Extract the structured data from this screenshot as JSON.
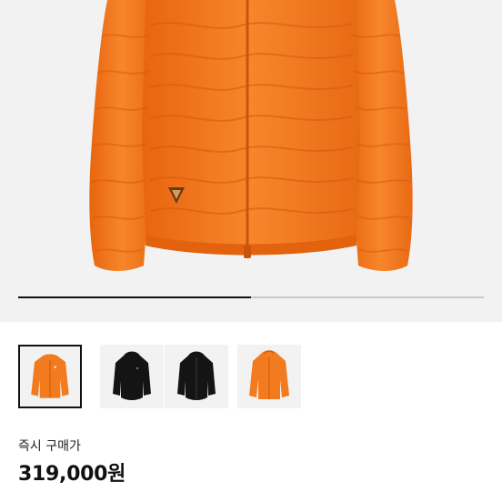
{
  "gallery": {
    "progress_fraction": 0.5,
    "image_count": 4,
    "selected_index": 0,
    "thumbnails": [
      {
        "icon": "orange-jacket-icon",
        "color": "#f27a1f"
      },
      {
        "icon": "black-jacket-icon",
        "color": "#141414"
      },
      {
        "icon": "black-jacket-icon",
        "color": "#141414"
      },
      {
        "icon": "orange-jacket-icon",
        "color": "#f27a1f"
      }
    ]
  },
  "product": {
    "price_label": "즉시 구매가",
    "price": "319,000원"
  },
  "colors": {
    "jacket_orange": "#f27a1f",
    "jacket_black": "#141414",
    "background_gray": "#f2f2f2"
  }
}
